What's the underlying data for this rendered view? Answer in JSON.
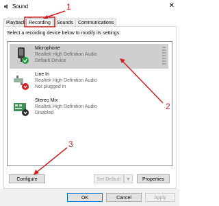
{
  "window": {
    "title": "Sound",
    "close_glyph": "✕"
  },
  "tabs": [
    "Playback",
    "Recording",
    "Sounds",
    "Communications"
  ],
  "instruction": "Select a recording device below to modify its settings:",
  "devices": [
    {
      "name": "Microphone",
      "line2": "Realtek High Definition Audio",
      "line3": "Default Device",
      "icon": "microphone-icon",
      "status": "check-badge"
    },
    {
      "name": "Line In",
      "line2": "Realtek High Definition Audio",
      "line3": "Not plugged in",
      "icon": "line-in-icon",
      "status": "unplugged-badge"
    },
    {
      "name": "Stereo Mix",
      "line2": "Realtek High Definition Audio",
      "line3": "Disabled",
      "icon": "stereo-mix-icon",
      "status": "disabled-badge"
    }
  ],
  "buttons": {
    "configure": "Configure",
    "set_default": "Set Default",
    "set_default_arrow": "▼",
    "properties": "Properties",
    "ok": "OK",
    "cancel": "Cancel",
    "apply": "Apply"
  },
  "annotations": [
    "1",
    "2",
    "3"
  ],
  "colors": {
    "annotation": "#d42020",
    "selection": "#cfcfcf",
    "check": "#1a9a3a",
    "red_badge": "#d42020"
  }
}
